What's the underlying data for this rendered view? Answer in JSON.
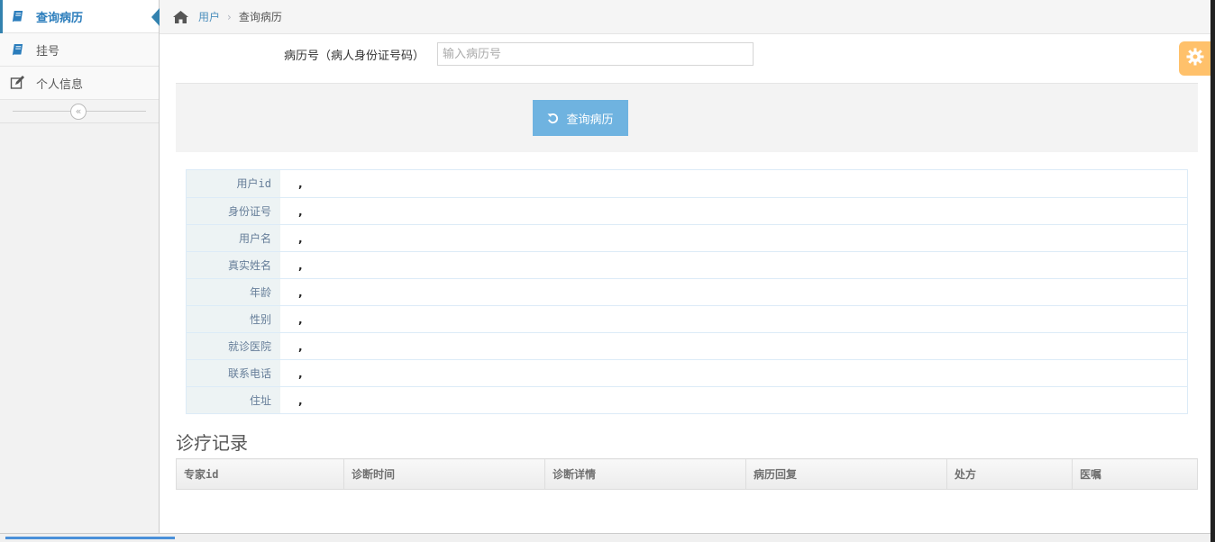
{
  "sidebar": {
    "items": [
      {
        "label": "查询病历",
        "icon": "book-icon",
        "active": true
      },
      {
        "label": "挂号",
        "icon": "book-icon",
        "active": false
      },
      {
        "label": "个人信息",
        "icon": "edit-icon",
        "active": false
      }
    ],
    "collapse_icon": "«"
  },
  "breadcrumb": {
    "home_icon": "home-icon",
    "parent": "用户",
    "separator": "›",
    "current": "查询病历"
  },
  "search": {
    "label": "病历号（病人身份证号码）",
    "placeholder": "输入病历号",
    "value": ""
  },
  "query_button": {
    "label": "查询病历",
    "icon": "undo-icon"
  },
  "patient_info": {
    "rows": [
      {
        "name": "用户id",
        "value": ","
      },
      {
        "name": "身份证号",
        "value": ","
      },
      {
        "name": "用户名",
        "value": ","
      },
      {
        "name": "真实姓名",
        "value": ","
      },
      {
        "name": "年龄",
        "value": ","
      },
      {
        "name": "性别",
        "value": ","
      },
      {
        "name": "就诊医院",
        "value": ","
      },
      {
        "name": "联系电话",
        "value": ","
      },
      {
        "name": "住址",
        "value": ","
      }
    ]
  },
  "records": {
    "title": "诊疗记录",
    "columns": [
      "专家id",
      "诊断时间",
      "诊断详情",
      "病历回复",
      "处方",
      "医嘱"
    ]
  },
  "colors": {
    "accent": "#2b7dbc",
    "button": "#6fb3e0",
    "settings": "#ffb752"
  }
}
